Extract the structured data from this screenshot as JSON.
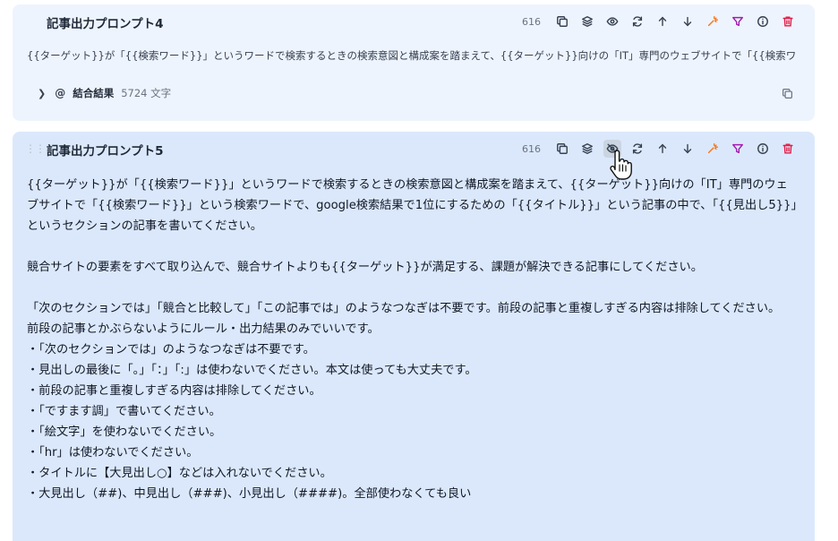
{
  "card1": {
    "title": "記事出力プロンプト4",
    "char_count": "616",
    "preview": "{{ターゲット}}が「{{検索ワード}}」というワードで検索するときの検索意図と構成案を踏まえて、{{ターゲット}}向けの「IT」専門のウェブサイトで「{{検索ワ",
    "result": {
      "at": "@",
      "label": "結合結果",
      "count": "5724 文字"
    }
  },
  "card2": {
    "title": "記事出力プロンプト5",
    "char_count": "616",
    "paragraphs": [
      "{{ターゲット}}が「{{検索ワード}}」というワードで検索するときの検索意図と構成案を踏まえて、{{ターゲット}}向けの「IT」専門のウェブサイトで「{{検索ワード}}」という検索ワードで、google検索結果で1位にするための「{{タイトル}}」という記事の中で、「{{見出し5}}」というセクションの記事を書いてください。",
      "",
      "競合サイトの要素をすべて取り込んで、競合サイトよりも{{ターゲット}}が満足する、課題が解決できる記事にしてください。",
      "",
      "「次のセクションでは」「競合と比較して」「この記事では」のようなつなぎは不要です。前段の記事と重複しすぎる内容は排除してください。",
      "前段の記事とかぶらないようにルール・出力結果のみでいいです。",
      "・「次のセクションでは」のようなつなぎは不要です。",
      "・見出しの最後に「。」「：」「:」は使わないでください。本文は使っても大丈夫です。",
      "・前段の記事と重複しすぎる内容は排除してください。",
      "・「ですます調」で書いてください。",
      "・「絵文字」を使わないでください。",
      "・「hr」は使わないでください。",
      "・タイトルに【大見出し○】などは入れないでください。",
      "・大見出し（##)、中見出し（###)、小見出し（####)。全部使わなくても良い"
    ]
  },
  "toolbar_icons": [
    "copy-icon",
    "layers-icon",
    "eye-icon",
    "refresh-icon",
    "arrow-up-icon",
    "arrow-down-icon",
    "sparkle-icon",
    "filter-icon",
    "info-icon",
    "trash-icon"
  ],
  "colors": {
    "card1_bg": "#eef4fd",
    "card2_bg": "#dbe8fb",
    "sparkle": "#f97316",
    "filter": "#a21caf",
    "trash": "#e11d48"
  }
}
